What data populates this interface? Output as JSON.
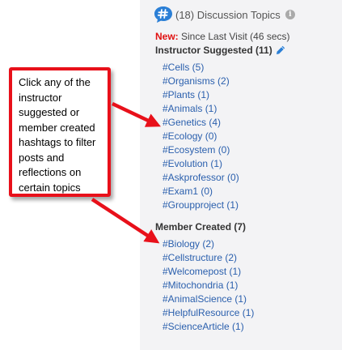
{
  "header": {
    "topics_label": "(18) Discussion Topics",
    "info_glyph": "i"
  },
  "new_line": {
    "new_label": "New:",
    "since_text": " Since Last Visit (46 secs)"
  },
  "instructor": {
    "title": "Instructor Suggested (11)",
    "tags": [
      "#Cells (5)",
      "#Organisms (2)",
      "#Plants (1)",
      "#Animals (1)",
      "#Genetics (4)",
      "#Ecology (0)",
      "#Ecosystem (0)",
      "#Evolution (1)",
      "#Askprofessor (0)",
      "#Exam1 (0)",
      "#Groupproject (1)"
    ]
  },
  "member": {
    "title": "Member Created (7)",
    "tags": [
      "#Biology (2)",
      "#Cellstructure (2)",
      "#Welcomepost (1)",
      "#Mitochondria (1)",
      "#AnimalScience (1)",
      "#HelpfulResource (1)",
      "#ScienceArticle (1)"
    ]
  },
  "callout": {
    "text": "Click any of the instructor suggested or member created hashtags to filter posts and reflections on certain topics"
  },
  "colors": {
    "accent_blue": "#2a5fad",
    "icon_blue": "#2b7fd6",
    "callout_red": "#e8101a",
    "new_red": "#e01010",
    "panel_bg": "#f3f3f5"
  },
  "icons": [
    "hashtag-bubble-icon",
    "info-icon",
    "pencil-icon"
  ]
}
